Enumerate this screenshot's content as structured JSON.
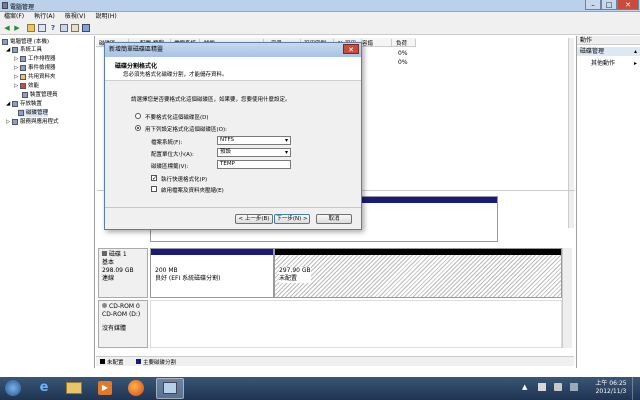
{
  "window": {
    "title": "電腦管理",
    "minimize": "–",
    "maximize": "□",
    "close": "✕"
  },
  "menu": [
    "檔案(F)",
    "執行(A)",
    "檢視(V)",
    "說明(H)"
  ],
  "toolbar_icons": [
    "back-arrow-icon",
    "forward-arrow-icon",
    "up-folder-icon",
    "properties-icon",
    "help-icon",
    "console-icon",
    "export-icon",
    "help-book-icon"
  ],
  "tree": {
    "root": "電腦管理 (本機)",
    "system_tools": "系統工具",
    "task_scheduler": "工作排程器",
    "event_viewer": "事件檢視器",
    "shared_folders": "共用資料夾",
    "performance": "效能",
    "device_manager": "裝置管理員",
    "storage": "存放裝置",
    "disk_management": "磁碟管理",
    "services": "服務與應用程式"
  },
  "volume_table": {
    "headers": [
      "磁碟區",
      "配置",
      "類型",
      "檔案系統",
      "狀態",
      "容量",
      "可用空間",
      "% 可用",
      "容錯",
      "負荷"
    ],
    "row1": {
      "free_pct": "0%"
    },
    "row2": {
      "free_pct": "0%"
    }
  },
  "actions": {
    "header": "動作",
    "section": "磁碟管理",
    "more": "其他動作"
  },
  "dialog": {
    "title": "新增簡單磁碟區精靈",
    "close": "✕",
    "heading": "磁碟分割格式化",
    "subheading": "您必須先格式化磁碟分割，才能儲存資料。",
    "prompt": "請選擇您是否要格式化這個磁碟區，如果要，您要使用什麼設定。",
    "option_no_format": "不要格式化這個磁碟區(D)",
    "option_format": "用下列設定格式化這個磁碟區(O):",
    "fs_label": "檔案系統(F):",
    "fs_value": "NTFS",
    "alloc_label": "配置單位大小(A):",
    "alloc_value": "預設",
    "volume_label": "磁碟區標籤(V):",
    "volume_value": "TEMP",
    "quick_format": "執行快速格式化(P)",
    "compression": "啟用檔案及資料夾壓縮(E)",
    "back": "< 上一步(B)",
    "next": "下一步(N) >",
    "cancel": "取消"
  },
  "disks": {
    "disk1": {
      "name": "磁碟 1",
      "type": "基本",
      "size": "298.09 GB",
      "status": "連線"
    },
    "part1": {
      "size": "200 MB",
      "status": "良好 (EFI 系統磁碟分割)"
    },
    "part2": {
      "size": "297.90 GB",
      "status": "未配置"
    },
    "cdrom": {
      "name": "CD-ROM 0",
      "type": "CD-ROM (D:)",
      "status": "沒有媒體"
    }
  },
  "legend": {
    "unallocated": "未配置",
    "primary": "主要磁碟分割"
  },
  "taskbar": {
    "time": "上午 06:25",
    "date": "2012/11/3",
    "apps": [
      "start-orb-icon",
      "internet-explorer-icon",
      "file-explorer-icon",
      "media-player-icon",
      "firefox-icon",
      "computer-management-icon"
    ]
  },
  "colors": {
    "primary_partition": "#1a1a7a",
    "unallocated": "#000000",
    "titlebar": "#b9d1ea"
  }
}
